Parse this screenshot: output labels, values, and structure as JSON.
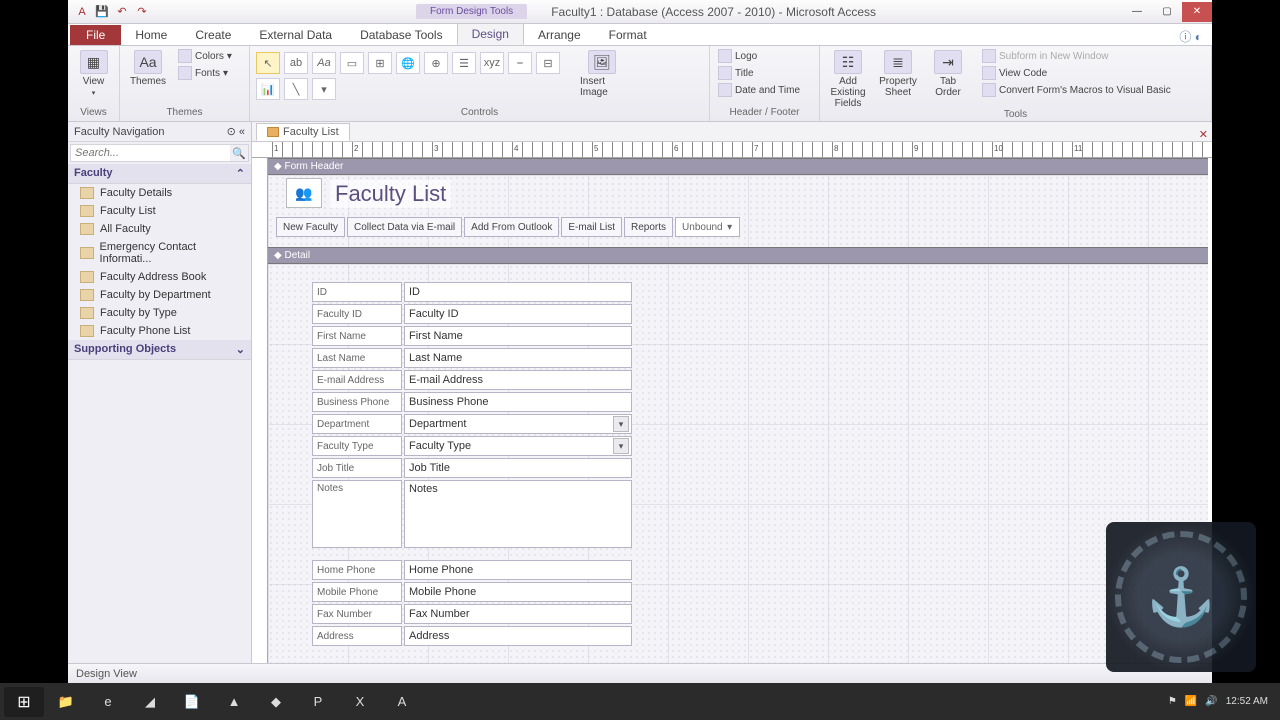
{
  "window": {
    "title": "Faculty1 : Database (Access 2007 - 2010) - Microsoft Access",
    "context_tab": "Form Design Tools"
  },
  "ribbon": {
    "tabs": {
      "file": "File",
      "home": "Home",
      "create": "Create",
      "external": "External Data",
      "dbtools": "Database Tools",
      "design": "Design",
      "arrange": "Arrange",
      "format": "Format"
    },
    "groups": {
      "views": "Views",
      "themes": "Themes",
      "controls": "Controls",
      "headerfooter": "Header / Footer",
      "tools": "Tools"
    },
    "items": {
      "view": "View",
      "themes": "Themes",
      "colors": "Colors",
      "fonts": "Fonts",
      "insert_image": "Insert Image",
      "logo": "Logo",
      "title": "Title",
      "datetime": "Date and Time",
      "add_fields": "Add Existing Fields",
      "prop_sheet": "Property Sheet",
      "tab_order": "Tab Order",
      "subform": "Subform in New Window",
      "view_code": "View Code",
      "convert": "Convert Form's Macros to Visual Basic"
    }
  },
  "nav": {
    "title": "Faculty Navigation",
    "search_placeholder": "Search...",
    "group1": "Faculty",
    "group2": "Supporting Objects",
    "items": {
      "details": "Faculty Details",
      "list": "Faculty List",
      "all": "All Faculty",
      "emergency": "Emergency Contact Informati...",
      "address": "Faculty Address Book",
      "bydept": "Faculty by Department",
      "bytype": "Faculty by Type",
      "phone": "Faculty Phone List"
    }
  },
  "form_tab": "Faculty List",
  "sections": {
    "header": "Form Header",
    "detail": "Detail"
  },
  "form_title": "Faculty List",
  "header_buttons": {
    "new": "New Faculty",
    "collect": "Collect Data via E-mail",
    "outlook": "Add From Outlook",
    "elist": "E-mail List",
    "reports": "Reports",
    "combo": "Unbound"
  },
  "fields": {
    "id": {
      "label": "ID",
      "control": "ID"
    },
    "facid": {
      "label": "Faculty ID",
      "control": "Faculty ID"
    },
    "fname": {
      "label": "First Name",
      "control": "First Name"
    },
    "lname": {
      "label": "Last Name",
      "control": "Last Name"
    },
    "email": {
      "label": "E-mail Address",
      "control": "E-mail Address"
    },
    "bphone": {
      "label": "Business Phone",
      "control": "Business Phone"
    },
    "dept": {
      "label": "Department",
      "control": "Department"
    },
    "ftype": {
      "label": "Faculty Type",
      "control": "Faculty Type"
    },
    "jtitle": {
      "label": "Job Title",
      "control": "Job Title"
    },
    "notes": {
      "label": "Notes",
      "control": "Notes"
    },
    "hphone": {
      "label": "Home Phone",
      "control": "Home Phone"
    },
    "mphone": {
      "label": "Mobile Phone",
      "control": "Mobile Phone"
    },
    "fax": {
      "label": "Fax Number",
      "control": "Fax Number"
    },
    "addr": {
      "label": "Address",
      "control": "Address"
    }
  },
  "status": "Design View",
  "tray_time": "12:52 AM"
}
